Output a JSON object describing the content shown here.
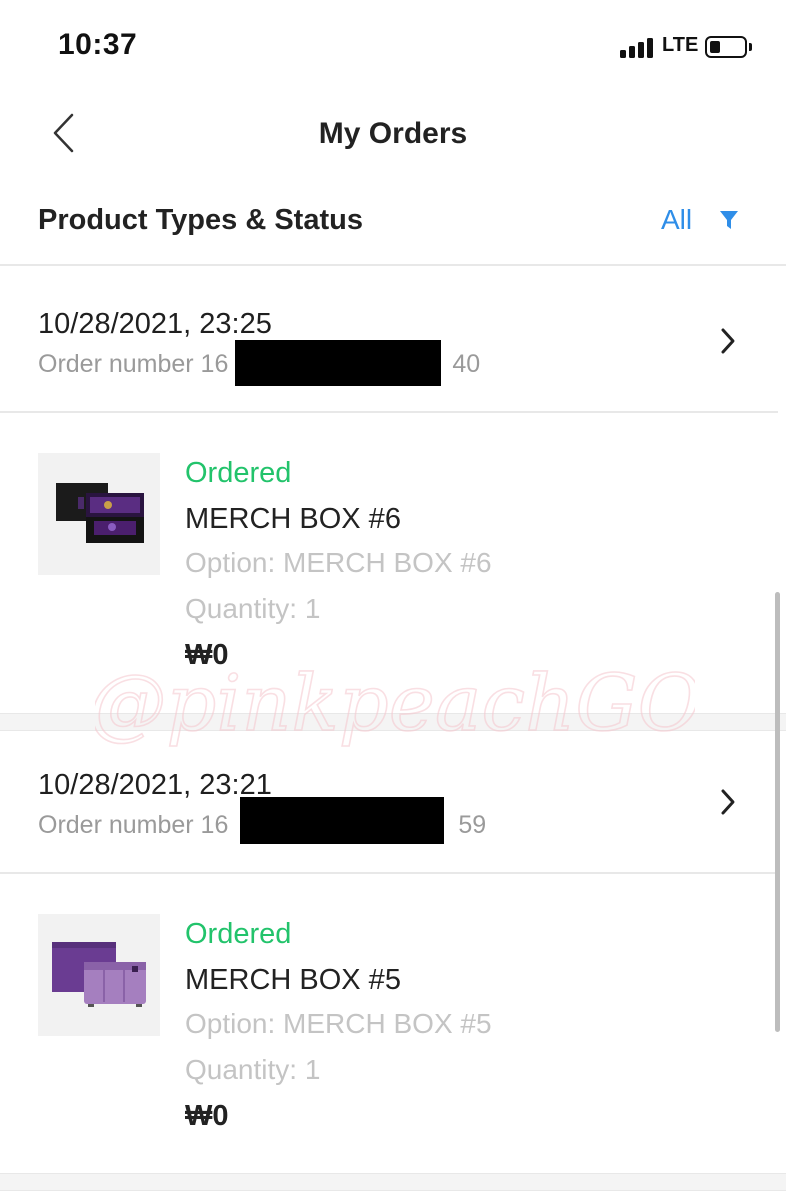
{
  "status_bar": {
    "time": "10:37",
    "network": "LTE"
  },
  "header": {
    "title": "My Orders"
  },
  "filter": {
    "label": "Product Types & Status",
    "value": "All"
  },
  "orders": [
    {
      "date": "10/28/2021, 23:25",
      "number_prefix": "Order number 16",
      "number_suffix": "40",
      "item": {
        "status": "Ordered",
        "name": "MERCH BOX #6",
        "option": "Option: MERCH BOX #6",
        "quantity": "Quantity: 1",
        "price": "₩0"
      }
    },
    {
      "date": "10/28/2021, 23:21",
      "number_prefix": "Order number 16",
      "number_suffix": "59",
      "item": {
        "status": "Ordered",
        "name": "MERCH BOX #5",
        "option": "Option: MERCH BOX #5",
        "quantity": "Quantity: 1",
        "price": "₩0"
      }
    }
  ],
  "watermark": "@pinkpeachGO",
  "colors": {
    "accent": "#2f8ee8",
    "status_green": "#22c36b",
    "muted": "#c4c4c4"
  }
}
